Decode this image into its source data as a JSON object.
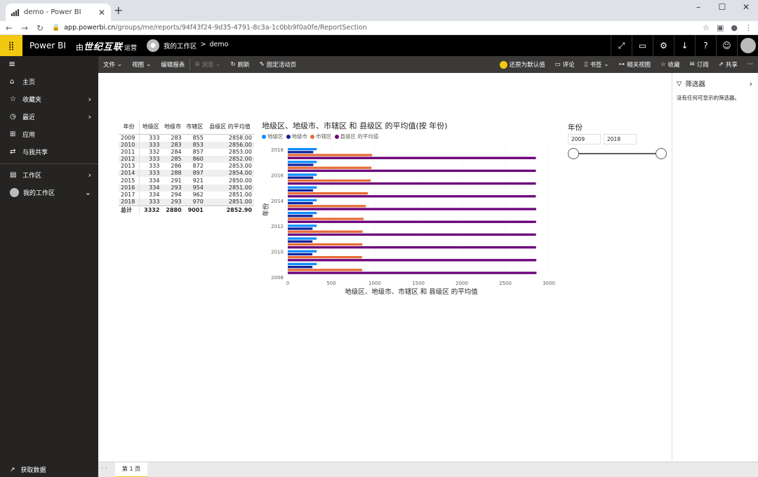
{
  "browser": {
    "tab_title": "demo - Power BI",
    "new_tab": "+",
    "url_domain": "app.powerbi.cn",
    "url_path": "/groups/me/reports/94f43f24-9d35-4791-8c3a-1c0bb9f0a0fe/ReportSection",
    "win_min": "–",
    "win_max": "☐",
    "win_close": "✕"
  },
  "header": {
    "app_name": "Power BI",
    "org_prefix": "由",
    "org_name": "世纪互联",
    "org_suffix": "运营",
    "breadcrumb_workspace": "我的工作区",
    "breadcrumb_sep": ">",
    "breadcrumb_report": "demo"
  },
  "commands": {
    "file": "文件",
    "view": "视图",
    "edit": "编辑报表",
    "browse": "浏览",
    "refresh": "刷新",
    "pin": "固定活动页",
    "reset": "还原为默认值",
    "comment": "评论",
    "bookmark": "书签",
    "related": "相关视图",
    "favorite": "收藏",
    "subscribe": "订阅",
    "share": "共享",
    "more": "···"
  },
  "leftnav": {
    "items": [
      {
        "label": "主页",
        "icon": "⌂"
      },
      {
        "label": "收藏夹",
        "icon": "☆"
      },
      {
        "label": "最近",
        "icon": "◷"
      },
      {
        "label": "应用",
        "icon": "⊞"
      },
      {
        "label": "与我共享",
        "icon": "⇄"
      }
    ],
    "workspaces": "工作区",
    "my_workspace": "我的工作区",
    "get_data": "获取数据"
  },
  "table": {
    "headers": [
      "年份",
      "地级区",
      "地级市",
      "市辖区",
      "县级区 的平均值"
    ],
    "rows": [
      [
        "2009",
        "333",
        "283",
        "855",
        "2858.00"
      ],
      [
        "2010",
        "333",
        "283",
        "853",
        "2856.00"
      ],
      [
        "2011",
        "332",
        "284",
        "857",
        "2853.00"
      ],
      [
        "2012",
        "333",
        "285",
        "860",
        "2852.00"
      ],
      [
        "2013",
        "333",
        "286",
        "872",
        "2853.00"
      ],
      [
        "2014",
        "333",
        "288",
        "897",
        "2854.00"
      ],
      [
        "2015",
        "334",
        "291",
        "921",
        "2850.00"
      ],
      [
        "2016",
        "334",
        "293",
        "954",
        "2851.00"
      ],
      [
        "2017",
        "334",
        "294",
        "962",
        "2851.00"
      ],
      [
        "2018",
        "333",
        "293",
        "970",
        "2851.00"
      ]
    ],
    "total": [
      "总计",
      "3332",
      "2880",
      "9001",
      "2852.90"
    ]
  },
  "chart_data": {
    "type": "bar",
    "orientation": "horizontal",
    "title": "地级区、地级市、市辖区 和 县级区 的平均值(按 年份)",
    "xlabel": "地级区、地级市、市辖区 和 县级区 的平均值",
    "ylabel": "年份",
    "xlim": [
      0,
      3000
    ],
    "x_ticks": [
      "0",
      "500",
      "1000",
      "1500",
      "2000",
      "2500",
      "3000"
    ],
    "y_ticks": [
      "2018",
      "2016",
      "2014",
      "2012",
      "2010",
      "2008"
    ],
    "categories": [
      "2018",
      "2017",
      "2016",
      "2015",
      "2014",
      "2013",
      "2012",
      "2011",
      "2010",
      "2009"
    ],
    "series": [
      {
        "name": "地级区",
        "color": "#118dff",
        "values": [
          333,
          334,
          334,
          334,
          333,
          333,
          333,
          332,
          333,
          333
        ]
      },
      {
        "name": "地级市",
        "color": "#12239e",
        "values": [
          293,
          294,
          293,
          291,
          288,
          286,
          285,
          284,
          283,
          283
        ]
      },
      {
        "name": "市辖区",
        "color": "#e66c37",
        "values": [
          970,
          962,
          954,
          921,
          897,
          872,
          860,
          857,
          853,
          855
        ]
      },
      {
        "name": "县级区 的平均值",
        "color": "#6b007b",
        "values": [
          2851,
          2851,
          2851,
          2850,
          2854,
          2853,
          2852,
          2853,
          2856,
          2858
        ]
      }
    ],
    "legend_labels": [
      "地级区",
      "地级市",
      "市辖区",
      "县级区 的平均值"
    ],
    "legend_position": "top-left"
  },
  "slicer": {
    "title": "年份",
    "from": "2009",
    "to": "2018",
    "min_fraction": 0,
    "max_fraction": 1
  },
  "filter_pane": {
    "title": "筛选器",
    "empty": "没有任何可显示的筛选器。"
  },
  "pages": {
    "prev_next": "‹ ›",
    "tab": "第 1 页"
  }
}
